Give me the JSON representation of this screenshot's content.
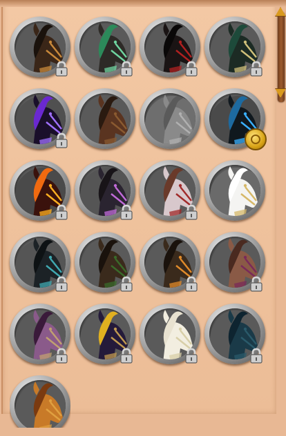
{
  "screen": {
    "title": ""
  },
  "colors": {
    "panel": "#efc29d",
    "scrollbar": "#9c5b2e",
    "scroll_arrow": "#d99a1e",
    "frame_silver": "#9a9a9a"
  },
  "mounts": [
    {
      "id": "m1",
      "coat": "#3a2618",
      "mane": "#1a120c",
      "accent": "#c8883a",
      "bg": "#5a5a5a",
      "locked": true
    },
    {
      "id": "m2",
      "coat": "#2d2a26",
      "mane": "#2c8a5a",
      "accent": "#6fd4a0",
      "bg": "#5a5a5a",
      "locked": true
    },
    {
      "id": "m3",
      "coat": "#1a1414",
      "mane": "#0a0808",
      "accent": "#b02020",
      "bg": "#5a5a5a",
      "locked": true
    },
    {
      "id": "m4",
      "coat": "#1c2b24",
      "mane": "#1d4a3a",
      "accent": "#d0c07a",
      "bg": "#5a5a5a",
      "locked": true
    },
    {
      "id": "m5",
      "coat": "#1a0f2a",
      "mane": "#6a28d0",
      "accent": "#a070ff",
      "bg": "#505050",
      "locked": true
    },
    {
      "id": "m6",
      "coat": "#5a3420",
      "mane": "#2a1a10",
      "accent": "#8a5a30",
      "bg": "#5a5a5a",
      "locked": false
    },
    {
      "id": "m7",
      "coat": "#8a8a8a",
      "mane": "#5a5a5a",
      "accent": "#b0b0b0",
      "bg": "#6e6e6e",
      "locked": false
    },
    {
      "id": "m8",
      "coat": "#10181e",
      "mane": "#1d6aa0",
      "accent": "#3ab0ff",
      "bg": "#4a4a4a",
      "locked": false,
      "coin": true
    },
    {
      "id": "m9",
      "coat": "#3a120c",
      "mane": "#f06a10",
      "accent": "#ffb020",
      "bg": "#4a4a4a",
      "locked": true
    },
    {
      "id": "m10",
      "coat": "#2a2430",
      "mane": "#181418",
      "accent": "#c06ad8",
      "bg": "#555555",
      "locked": true
    },
    {
      "id": "m11",
      "coat": "#d8c8cc",
      "mane": "#6a3a2a",
      "accent": "#a02a2a",
      "bg": "#5a5a5a",
      "locked": true
    },
    {
      "id": "m12",
      "coat": "#f4f4f2",
      "mane": "#ffffff",
      "accent": "#d6b868",
      "bg": "#6a6a6a",
      "locked": false
    },
    {
      "id": "m13",
      "coat": "#1c2226",
      "mane": "#0e1214",
      "accent": "#40a8b0",
      "bg": "#555555",
      "locked": true
    },
    {
      "id": "m14",
      "coat": "#3a2a1c",
      "mane": "#1a120c",
      "accent": "#3a6a2a",
      "bg": "#5a5a5a",
      "locked": true
    },
    {
      "id": "m15",
      "coat": "#3a2a1c",
      "mane": "#1a120c",
      "accent": "#e08a2a",
      "bg": "#5a5a5a",
      "locked": true
    },
    {
      "id": "m16",
      "coat": "#8a5a46",
      "mane": "#4a2a20",
      "accent": "#7a2a5a",
      "bg": "#5a5a5a",
      "locked": true
    },
    {
      "id": "m17",
      "coat": "#8a5a8a",
      "mane": "#3a1a3a",
      "accent": "#c0a070",
      "bg": "#5a5a5a",
      "locked": true
    },
    {
      "id": "m18",
      "coat": "#241a3a",
      "mane": "#e0b020",
      "accent": "#c09a50",
      "bg": "#5a5a5a",
      "locked": true
    },
    {
      "id": "m19",
      "coat": "#f2eee0",
      "mane": "#e8e2d0",
      "accent": "#d8cfa8",
      "bg": "#5a5a5a",
      "locked": true
    },
    {
      "id": "m20",
      "coat": "#1a3a48",
      "mane": "#0e2430",
      "accent": "#2a5a6a",
      "bg": "#5a5a5a",
      "locked": true
    },
    {
      "id": "m21",
      "coat": "#c87a28",
      "mane": "#7a3a10",
      "accent": "#e0a040",
      "bg": "#5a5a5a",
      "locked": false,
      "partial": true
    }
  ]
}
